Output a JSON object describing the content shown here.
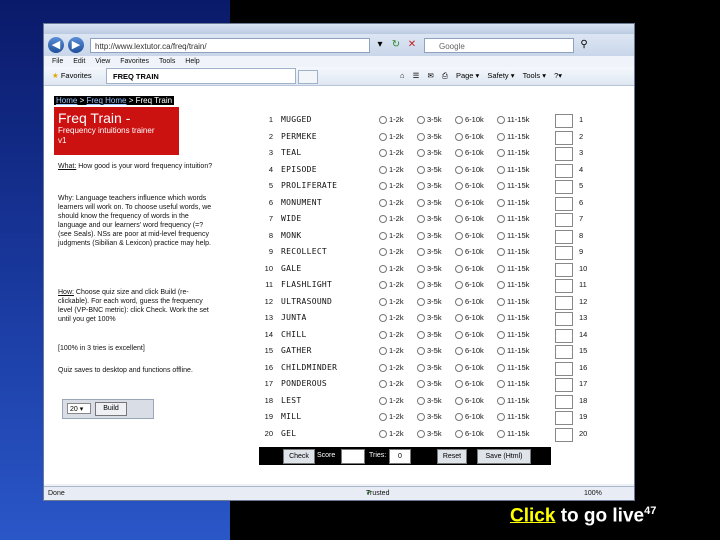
{
  "browser": {
    "url": "http://www.lextutor.ca/freq/train/",
    "search_placeholder": "Google",
    "menu": [
      "File",
      "Edit",
      "View",
      "Favorites",
      "Tools",
      "Help"
    ],
    "favorites_label": "Favorites",
    "tab_title": "FREQ TRAIN",
    "tools": [
      "Page ▾",
      "Safety ▾",
      "Tools ▾",
      "?▾"
    ],
    "status_left": "Done",
    "status_mid": "Trusted sites | Protected Mode: Off",
    "status_zoom": "100%"
  },
  "page": {
    "breadcrumb": {
      "home": "Home",
      "sep1": " > ",
      "freq_home": "Freq Home",
      "sep2": " > ",
      "current": "Freq Train"
    },
    "title": "Freq Train -",
    "subtitle": "Frequency intuitions trainer",
    "version": "v1",
    "what_label": "What:",
    "what_text": "How good is your word frequency intuition?",
    "why_text": "Why: Language teachers influence which words learners will work on. To choose useful words, we should know the frequency of words in the language and our learners' word frequency (=? (see Seals). NSs are poor at mid-level frequency judgments (Sibilian & Lexicon) practice may help.",
    "how_label": "How:",
    "how_text": "Choose quiz size and click Build (re-clickable). For each word, guess the frequency level (VP-BNC metric): click Check. Work the set until you get 100%",
    "tip_text": "[100% in 3 tries is excellent]",
    "save_text": "Quiz saves to desktop and functions offline.",
    "quiz_size": "20",
    "build_label": "Build"
  },
  "quiz": {
    "options": [
      "1-2k",
      "3-5k",
      "6-10k",
      "11-15k"
    ],
    "rows": [
      {
        "n": "1",
        "word": "MUGGED"
      },
      {
        "n": "2",
        "word": "PERMEKE"
      },
      {
        "n": "3",
        "word": "TEAL"
      },
      {
        "n": "4",
        "word": "EPISODE"
      },
      {
        "n": "5",
        "word": "PROLIFERATE"
      },
      {
        "n": "6",
        "word": "MONUMENT"
      },
      {
        "n": "7",
        "word": "WIDE"
      },
      {
        "n": "8",
        "word": "MONK"
      },
      {
        "n": "9",
        "word": "RECOLLECT"
      },
      {
        "n": "10",
        "word": "GALE"
      },
      {
        "n": "11",
        "word": "FLASHLIGHT"
      },
      {
        "n": "12",
        "word": "ULTRASOUND"
      },
      {
        "n": "13",
        "word": "JUNTA"
      },
      {
        "n": "14",
        "word": "CHILL"
      },
      {
        "n": "15",
        "word": "GATHER"
      },
      {
        "n": "16",
        "word": "CHILDMINDER"
      },
      {
        "n": "17",
        "word": "PONDEROUS"
      },
      {
        "n": "18",
        "word": "LEST"
      },
      {
        "n": "19",
        "word": "MILL"
      },
      {
        "n": "20",
        "word": "GEL"
      }
    ],
    "check_label": "Check",
    "score_label": "Score",
    "tries_label": "Tries:",
    "tries_value": "0",
    "reset_label": "Reset",
    "save_label": "Save (Html)"
  },
  "slide": {
    "link_text": "Click",
    "footer_text": " to go live",
    "slide_number": "47"
  }
}
